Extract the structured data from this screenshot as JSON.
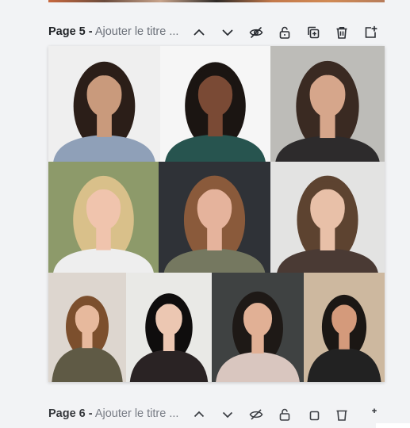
{
  "page5": {
    "page_number_label": "Page 5 -",
    "title_placeholder": "Ajouter le titre  ...",
    "toolbar": [
      {
        "name": "move-up-button",
        "icon": "chevron-up-icon"
      },
      {
        "name": "move-down-button",
        "icon": "chevron-down-icon"
      },
      {
        "name": "hide-page-button",
        "icon": "eye-slash-icon"
      },
      {
        "name": "lock-page-button",
        "icon": "unlock-icon"
      },
      {
        "name": "duplicate-page-button",
        "icon": "duplicate-icon"
      },
      {
        "name": "delete-page-button",
        "icon": "trash-icon"
      },
      {
        "name": "add-page-button",
        "icon": "add-page-icon"
      }
    ],
    "photos": [
      {
        "bg": "#efefef",
        "hair": "#2b1e18",
        "skin": "#c99a7c",
        "clothes": "#8fa0b8"
      },
      {
        "bg": "#f6f6f6",
        "hair": "#1b1512",
        "skin": "#7a4a35",
        "clothes": "#27544f"
      },
      {
        "bg": "#bdbcb8",
        "hair": "#3a2a22",
        "skin": "#d6a68b",
        "clothes": "#2d2b2c"
      },
      {
        "bg": "#8d9a6a",
        "hair": "#d9c08a",
        "skin": "#f0c4ad",
        "clothes": "#eeeeee"
      },
      {
        "bg": "#2f3237",
        "hair": "#8a5a3b",
        "skin": "#e5b39c",
        "clothes": "#757860"
      },
      {
        "bg": "#e3e3e2",
        "hair": "#5d4330",
        "skin": "#e8c0a8",
        "clothes": "#4a3a34"
      },
      {
        "bg": "#ddd6cf",
        "hair": "#7c4f2d",
        "skin": "#e7b99d",
        "clothes": "#5f5a45"
      },
      {
        "bg": "#e9e9e6",
        "hair": "#0f0d0d",
        "skin": "#ecc7b2",
        "clothes": "#2a2324"
      },
      {
        "bg": "#3f4242",
        "hair": "#1e1916",
        "skin": "#e1b095",
        "clothes": "#d9c6bf"
      },
      {
        "bg": "#cdb89f",
        "hair": "#1b1714",
        "skin": "#d49a7b",
        "clothes": "#222222"
      }
    ]
  },
  "page6": {
    "page_number_label": "Page 6 -",
    "title_placeholder": "Ajouter le titre  ..."
  }
}
